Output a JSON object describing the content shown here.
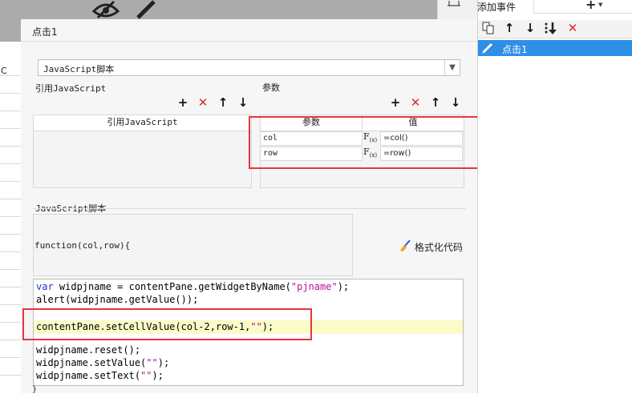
{
  "background": {
    "column_label": "C"
  },
  "dialog": {
    "title": "点击1",
    "script_type": {
      "selected": "JavaScript脚本"
    },
    "ref_js": {
      "label": "引用JavaScript",
      "column_header": "引用JavaScript"
    },
    "params": {
      "label": "参数",
      "columns": [
        "参数",
        "值"
      ],
      "rows": [
        {
          "name": "col",
          "fx": "F",
          "fx_sub": "(x)",
          "value": "=col()"
        },
        {
          "name": "row",
          "fx": "F",
          "fx_sub": "(x)",
          "value": "=row()"
        }
      ]
    },
    "toolbar_icons": [
      "plus-icon",
      "delete-icon",
      "arrow-up-icon",
      "arrow-down-icon"
    ],
    "script_section": {
      "label": "JavaScript脚本",
      "signature": "function(col,row){",
      "format_button": "格式化代码",
      "closing_brace": "}"
    },
    "code_lines": [
      {
        "kw": "var",
        "rest": " widpjname = contentPane.getWidgetByName(",
        "str": "\"pjname\"",
        "tail": ");"
      },
      {
        "kw": "",
        "rest": "alert(widpjname.getValue());",
        "str": "",
        "tail": ""
      },
      {
        "kw": "",
        "rest": "",
        "str": "",
        "tail": ""
      },
      {
        "kw": "",
        "rest": "contentPane.setCellValue(col-2,row-1,",
        "str": "\"\"",
        "tail": ");"
      },
      {
        "kw": "",
        "rest": "",
        "str": "",
        "tail": ""
      },
      {
        "kw": "",
        "rest": "widpjname.reset();",
        "str": "",
        "tail": ""
      },
      {
        "kw": "",
        "rest": "widpjname.setValue(",
        "str": "\"\"",
        "tail": ");"
      },
      {
        "kw": "",
        "rest": "widpjname.setText(",
        "str": "\"\"",
        "tail": ");"
      }
    ]
  },
  "right_panel": {
    "title": "添加事件",
    "add_icon": "+",
    "events": [
      "点击1"
    ]
  },
  "colors": {
    "accent": "#2f8ee6",
    "annotation_red": "#e8343b",
    "keyword": "#1c33cf",
    "string": "#b3129c",
    "highlight": "#fbfbc8"
  }
}
